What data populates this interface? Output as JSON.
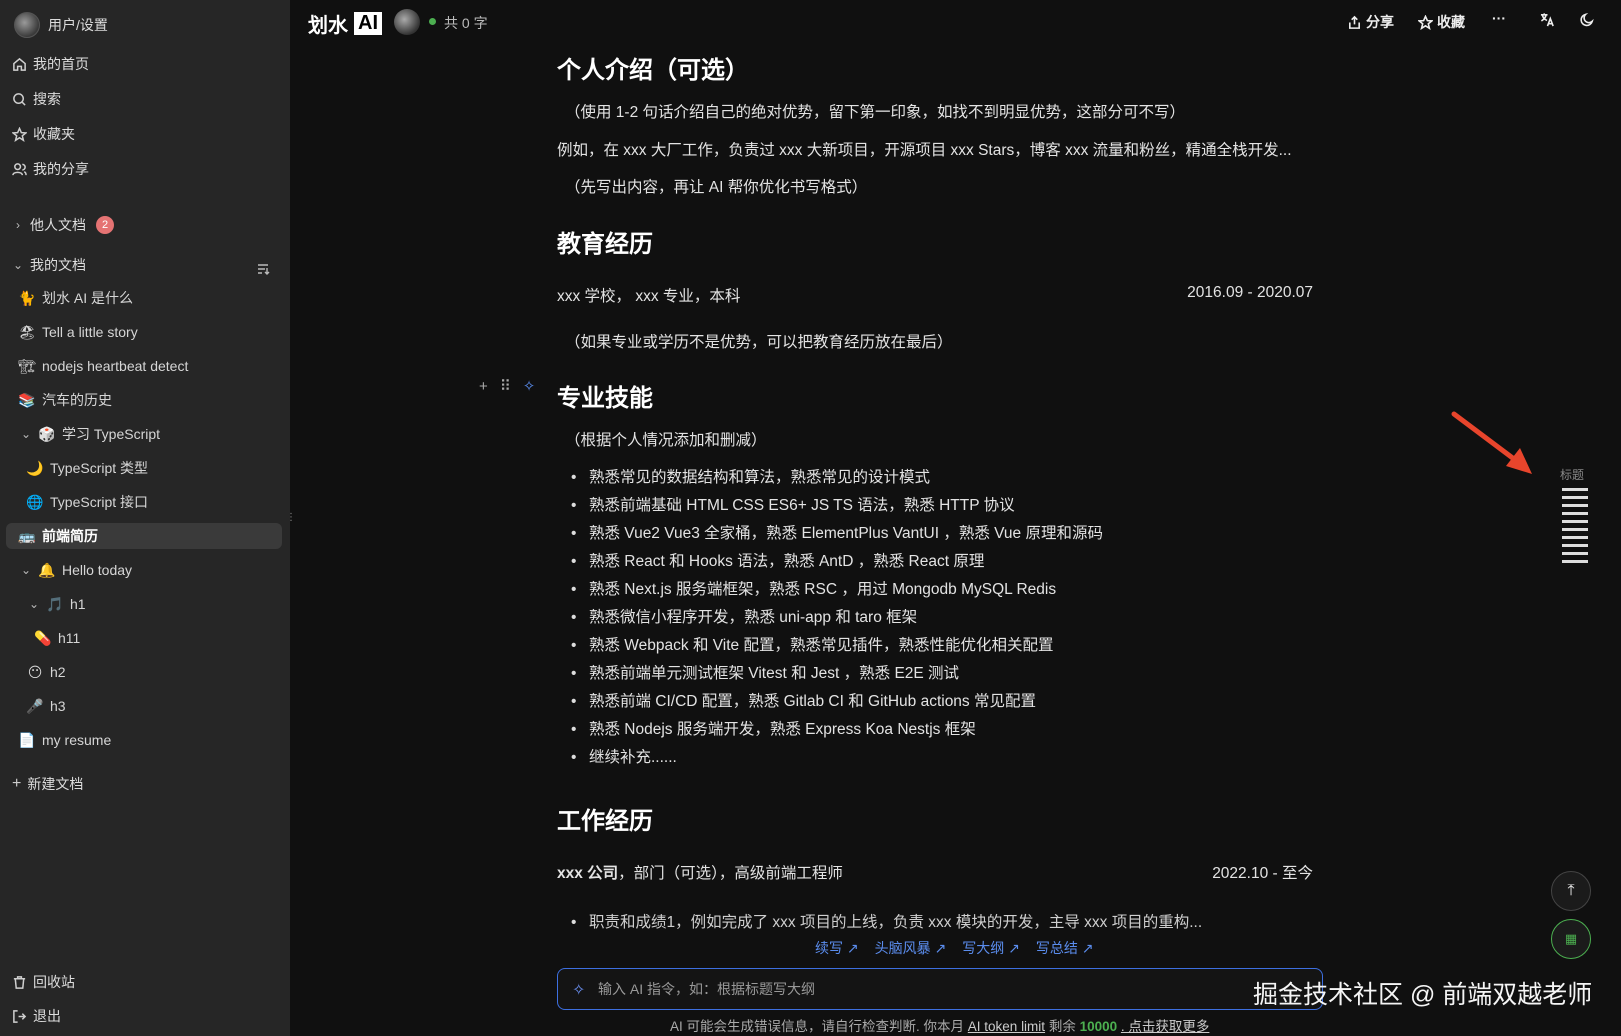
{
  "sidebar": {
    "user_label": "用户/设置",
    "nav": [
      {
        "label": "我的首页",
        "icon": "home-icon"
      },
      {
        "label": "搜索",
        "icon": "search-icon"
      },
      {
        "label": "收藏夹",
        "icon": "star-icon"
      },
      {
        "label": "我的分享",
        "icon": "users-icon"
      }
    ],
    "others_docs": {
      "label": "他人文档",
      "badge": "2"
    },
    "my_docs_label": "我的文档",
    "docs": [
      {
        "emoji": "🐈",
        "label": "划水 AI 是什么"
      },
      {
        "emoji": "🏖",
        "label": "Tell a little story"
      },
      {
        "emoji": "🏗",
        "label": "nodejs heartbeat detect"
      },
      {
        "emoji": "📚",
        "label": "汽车的历史"
      },
      {
        "emoji": "🎲",
        "label": "学习 TypeScript"
      },
      {
        "emoji": "🌙",
        "label": "TypeScript 类型"
      },
      {
        "emoji": "🌐",
        "label": "TypeScript 接口"
      },
      {
        "emoji": "🚌",
        "label": "前端简历"
      },
      {
        "emoji": "🔔",
        "label": "Hello today"
      },
      {
        "emoji": "🎵",
        "label": "h1"
      },
      {
        "emoji": "💊",
        "label": "h11"
      },
      {
        "emoji": "😶",
        "label": "h2"
      },
      {
        "emoji": "🎤",
        "label": "h3"
      },
      {
        "emoji": "📄",
        "label": "my resume"
      }
    ],
    "new_doc": "新建文档",
    "trash": "回收站",
    "logout": "退出"
  },
  "topbar": {
    "logo_part1": "划水",
    "logo_part2": "AI",
    "word_count": "共 0 字",
    "share": "分享",
    "favorite": "收藏",
    "more": "···"
  },
  "doc": {
    "intro_title": "个人介绍（可选）",
    "intro_p1": "（使用 1-2 句话介绍自己的绝对优势，留下第一印象，如找不到明显优势，这部分可不写）",
    "intro_p2": "例如，在 xxx 大厂工作，负责过 xxx 大新项目，开源项目 xxx Stars，博客 xxx 流量和粉丝，精通全栈开发...",
    "intro_p3": "（先写出内容，再让 AI 帮你优化书写格式）",
    "edu_title": "教育经历",
    "edu_line": "xxx 学校， xxx 专业，本科",
    "edu_date": "2016.09 - 2020.07",
    "edu_note": "（如果专业或学历不是优势，可以把教育经历放在最后）",
    "skills_title": "专业技能",
    "skills_note": "（根据个人情况添加和删减）",
    "skills": [
      "熟悉常见的数据结构和算法，熟悉常见的设计模式",
      "熟悉前端基础 HTML CSS ES6+ JS TS 语法，熟悉 HTTP 协议",
      "熟悉 Vue2 Vue3 全家桶，熟悉 ElementPlus VantUI ，熟悉 Vue 原理和源码",
      "熟悉 React 和 Hooks 语法，熟悉 AntD ，熟悉 React 原理",
      "熟悉 Next.js 服务端框架，熟悉 RSC ，用过 Mongodb MySQL Redis",
      "熟悉微信小程序开发，熟悉 uni-app 和 taro 框架",
      "熟悉 Webpack 和 Vite 配置，熟悉常见插件，熟悉性能优化相关配置",
      "熟悉前端单元测试框架 Vitest 和 Jest ，熟悉 E2E 测试",
      "熟悉前端 CI/CD 配置，熟悉 Gitlab CI 和 GitHub actions 常见配置",
      "熟悉 Nodejs 服务端开发，熟悉 Express Koa Nestjs 框架",
      "继续补充......"
    ],
    "work_title": "工作经历",
    "work_company": "xxx 公司",
    "work_rest": "，部门（可选），高级前端工程师",
    "work_date": "2022.10 - 至今",
    "work_item": "职责和成绩1，例如完成了 xxx 项目的上线，负责 xxx 模块的开发，主导 xxx 项目的重构..."
  },
  "ai": {
    "links": [
      "续写 ↗",
      "头脑风暴 ↗",
      "写大纲 ↗",
      "写总结 ↗"
    ],
    "placeholder": "输入 AI 指令，如：根据标题写大纲",
    "disclaimer_prefix": "AI 可能会生成错误信息，请自行检查判断. 你本月",
    "token_link": "AI token limit",
    "disclaimer_mid": "剩余",
    "remaining": "10000",
    "more_link": ". 点击获取更多"
  },
  "toc": {
    "label": "标题"
  },
  "watermark": "掘金技术社区 @ 前端双越老师"
}
